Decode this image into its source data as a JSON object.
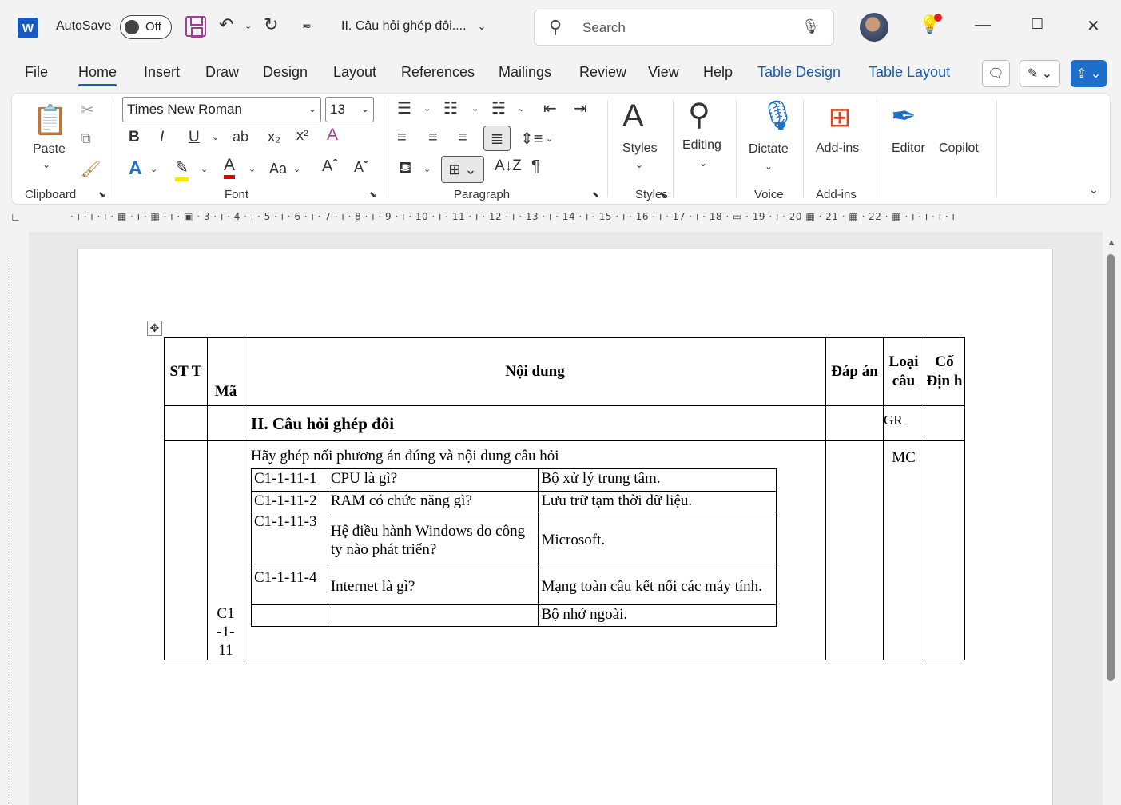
{
  "titlebar": {
    "app_logo": "W",
    "autosave_label": "AutoSave",
    "autosave_state": "Off",
    "doc_title": "II. Câu hỏi ghép đôi....",
    "search_placeholder": "Search"
  },
  "menu": {
    "tabs": [
      "File",
      "Home",
      "Insert",
      "Draw",
      "Design",
      "Layout",
      "References",
      "Mailings",
      "Review",
      "View",
      "Help",
      "Table Design",
      "Table Layout"
    ],
    "active_tab": "Home"
  },
  "ribbon": {
    "clipboard": {
      "paste_label": "Paste",
      "group_label": "Clipboard"
    },
    "font": {
      "font_name": "Times New Roman",
      "font_size": "13",
      "group_label": "Font",
      "change_case": "Aa"
    },
    "paragraph": {
      "group_label": "Paragraph"
    },
    "styles": {
      "label": "Styles",
      "group_label": "Styles"
    },
    "editing": {
      "label": "Editing"
    },
    "voice": {
      "label": "Dictate",
      "group_label": "Voice"
    },
    "addins": {
      "label": "Add-ins",
      "group_label": "Add-ins"
    },
    "editor": {
      "label": "Editor"
    },
    "copilot": {
      "label": "Copilot"
    }
  },
  "ruler": {
    "numbers": "· ı · ı · ı · ▦ · ı · ▦ · ı · ▣ · 3 · ı · 4 · ı · 5 · ı · 6 · ı · 7 · ı · 8 · ı · 9 · ı · 10 · ı · 11 · ı · 12 · ı · 13 · ı · 14 · ı · 15 · ı · 16 · ı · 17 · ı · 18 · ▭ · 19 · ı · 20 ▦ · 21 · ▦ · 22 · ▦ · ı · ı · ı · ı"
  },
  "document": {
    "header": {
      "stt": "ST T",
      "ma": "Mã",
      "noi_dung": "Nội dung",
      "dap_an": "Đáp án",
      "loai_cau": "Loại câu",
      "co_dinh": "Cố Địn h"
    },
    "section_row": {
      "title": "II. Câu hỏi ghép đôi",
      "loai": "GR"
    },
    "question_row": {
      "ma": "C1 -1- 11",
      "instruction": "Hãy ghép nối phương án đúng và nội dung câu hỏi",
      "loai": "MC",
      "pairs": [
        {
          "code": "C1-1-11-1",
          "question": "CPU là gì?",
          "answer": "Bộ xử lý trung tâm."
        },
        {
          "code": "C1-1-11-2",
          "question": "RAM có chức năng gì?",
          "answer": "Lưu trữ tạm thời dữ liệu."
        },
        {
          "code": "C1-1-11-3",
          "question": "Hệ điều hành Windows do công ty nào phát triển?",
          "answer": "Microsoft."
        },
        {
          "code": "C1-1-11-4",
          "question": "Internet là gì?",
          "answer": "Mạng toàn cầu kết nối các máy tính."
        },
        {
          "code": "",
          "question": "",
          "answer": "Bộ nhớ ngoài."
        }
      ]
    }
  },
  "colors": {
    "accent": "#185abd",
    "save": "#a23d96",
    "share": "#1e6fc8"
  }
}
